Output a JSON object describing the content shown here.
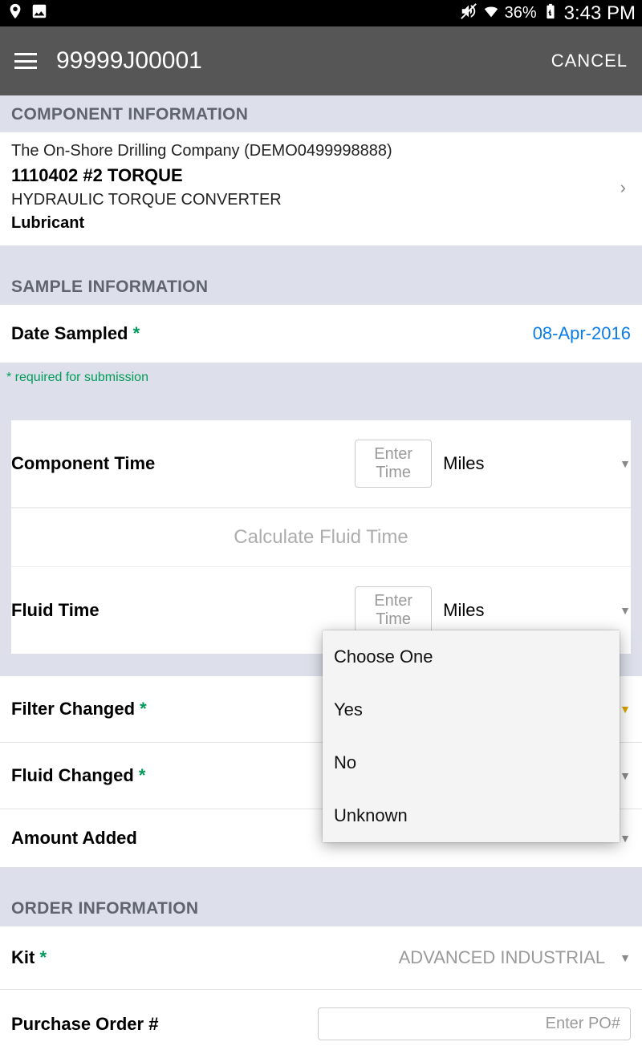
{
  "status": {
    "battery": "36%",
    "time": "3:43 PM"
  },
  "app": {
    "title": "99999J00001",
    "cancel": "CANCEL"
  },
  "sections": {
    "component": "COMPONENT INFORMATION",
    "sample": "SAMPLE INFORMATION",
    "order": "ORDER INFORMATION"
  },
  "component": {
    "company": "The On-Shore Drilling Company (DEMO0499998888)",
    "code": "1110402 #2 TORQUE",
    "desc": "HYDRAULIC TORQUE CONVERTER",
    "type": "Lubricant"
  },
  "sample": {
    "date_label": "Date Sampled",
    "date_value": "08-Apr-2016",
    "required_note": "* required for submission",
    "component_time_label": "Component Time",
    "component_time_placeholder": "Enter Time",
    "component_time_unit": "Miles",
    "calculate_label": "Calculate Fluid Time",
    "fluid_time_label": "Fluid Time",
    "fluid_time_placeholder": "Enter Time",
    "fluid_time_unit": "Miles",
    "filter_changed_label": "Filter Changed",
    "fluid_changed_label": "Fluid Changed",
    "amount_added_label": "Amount Added"
  },
  "dropdown": {
    "opt0": "Choose One",
    "opt1": "Yes",
    "opt2": "No",
    "opt3": "Unknown"
  },
  "order": {
    "kit_label": "Kit",
    "kit_value": "ADVANCED INDUSTRIAL",
    "po_label": "Purchase Order #",
    "po_placeholder": "Enter PO#"
  }
}
